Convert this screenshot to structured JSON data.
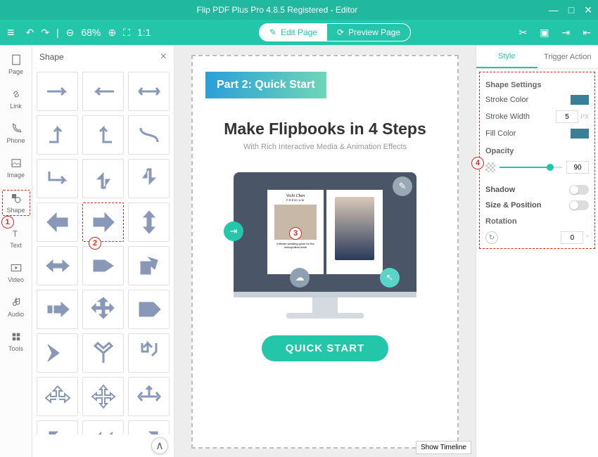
{
  "app": {
    "title": "Flip PDF Plus Pro 4.8.5 Registered - Editor"
  },
  "toolbar": {
    "zoom": "68%",
    "edit_page": "Edit Page",
    "preview_page": "Preview Page"
  },
  "leftrail": {
    "items": [
      {
        "label": "Page"
      },
      {
        "label": "Link"
      },
      {
        "label": "Phone"
      },
      {
        "label": "Image"
      },
      {
        "label": "Shape"
      },
      {
        "label": "Text"
      },
      {
        "label": "Video"
      },
      {
        "label": "Audio"
      },
      {
        "label": "Tools"
      }
    ]
  },
  "shape_panel": {
    "title": "Shape"
  },
  "canvas": {
    "part2": "Part 2: Quick Start",
    "headline": "Make Flipbooks in 4 Steps",
    "subheadline": "With Rich Interactive Media & Animation Effects",
    "flipbook_brand": "Vichi Chen",
    "flipbook_tag": "PREMIUM",
    "flipbook_caption": "Intricate wedding gown for the metropolitan bride",
    "quick_start": "QUICK START",
    "show_timeline": "Show Timeline"
  },
  "style_panel": {
    "tab_style": "Style",
    "tab_trigger": "Trigger Action",
    "section": "Shape Settings",
    "stroke_color": "Stroke Color",
    "stroke_width": "Stroke Width",
    "stroke_width_val": "5",
    "stroke_width_unit": "PX",
    "fill_color": "Fill Color",
    "opacity": "Opacity",
    "opacity_val": "90",
    "shadow": "Shadow",
    "size_pos": "Size & Position",
    "rotation": "Rotation",
    "rotation_val": "0",
    "colors": {
      "stroke": "#3a7f99",
      "fill": "#3a7f99"
    }
  },
  "badges": {
    "b1": "1",
    "b2": "2",
    "b3": "3",
    "b4": "4"
  }
}
